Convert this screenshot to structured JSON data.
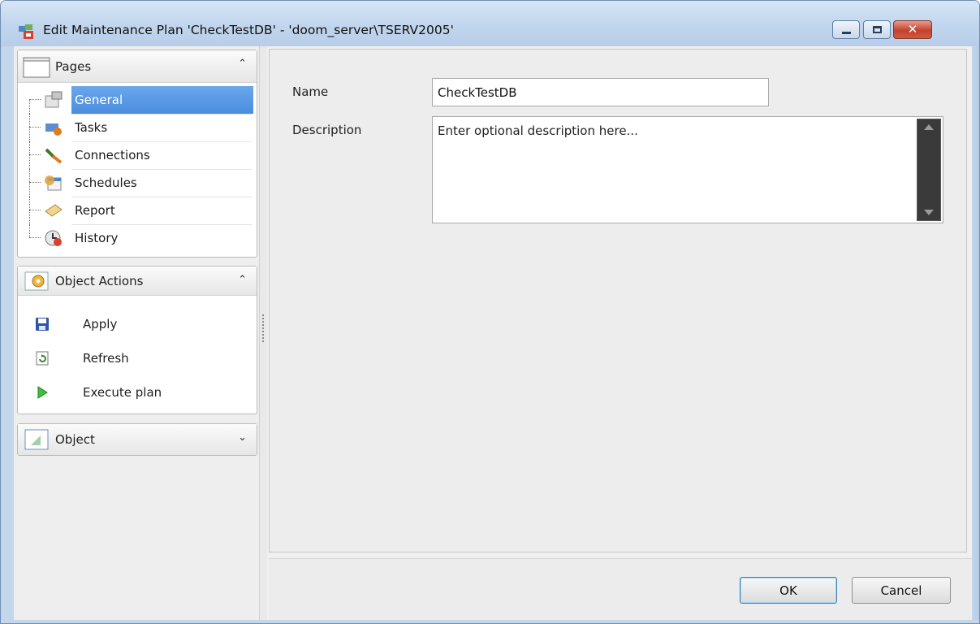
{
  "window": {
    "title": "Edit Maintenance Plan 'CheckTestDB' - 'doom_server\\TSERV2005'",
    "buttons": {
      "minimize": "minimize",
      "maximize": "maximize",
      "close": "✕"
    }
  },
  "pages_group": {
    "title": "Pages",
    "items": [
      {
        "label": "General",
        "icon": "general-icon",
        "selected": true
      },
      {
        "label": "Tasks",
        "icon": "tasks-icon",
        "selected": false
      },
      {
        "label": "Connections",
        "icon": "connections-icon",
        "selected": false
      },
      {
        "label": "Schedules",
        "icon": "schedules-icon",
        "selected": false
      },
      {
        "label": "Report",
        "icon": "report-icon",
        "selected": false
      },
      {
        "label": "History",
        "icon": "history-icon",
        "selected": false
      }
    ]
  },
  "actions_group": {
    "title": "Object Actions",
    "items": [
      {
        "label": "Apply",
        "icon": "save-icon"
      },
      {
        "label": "Refresh",
        "icon": "refresh-icon"
      },
      {
        "label": "Execute plan",
        "icon": "play-icon"
      }
    ]
  },
  "object_group": {
    "title": "Object"
  },
  "form": {
    "name_label": "Name",
    "name_value": "CheckTestDB",
    "description_label": "Description",
    "description_placeholder": "Enter optional description here..."
  },
  "footer": {
    "ok_label": "OK",
    "cancel_label": "Cancel"
  },
  "colors": {
    "selection": "#4a8ddf",
    "title_bar": "#c2d6ee",
    "close_button": "#c2412c"
  }
}
